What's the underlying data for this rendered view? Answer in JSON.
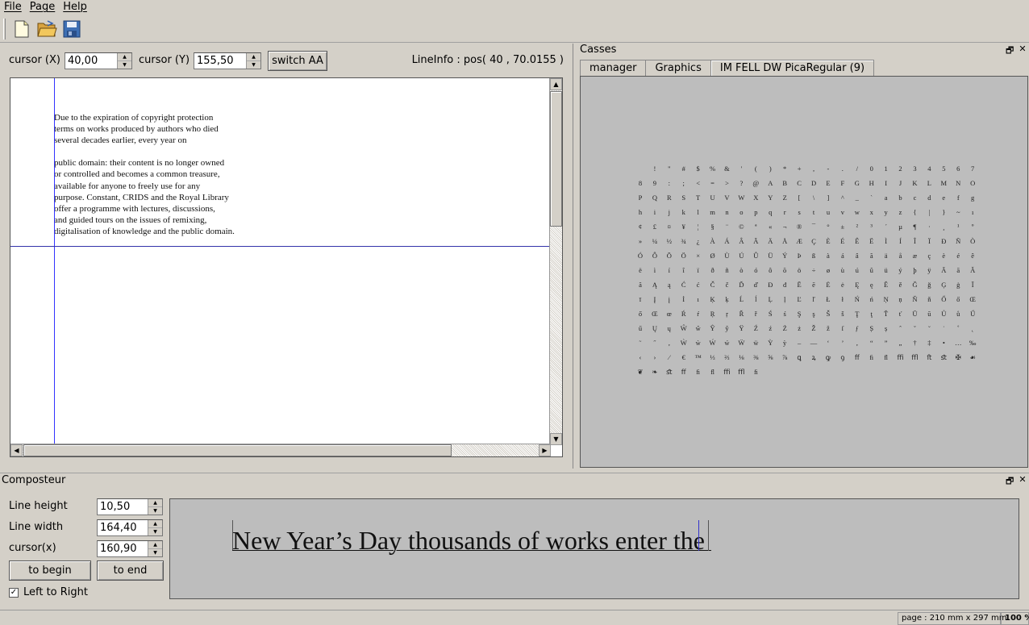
{
  "menu": {
    "file": "File",
    "page": "Page",
    "help": "Help"
  },
  "toolbar": {
    "new": "new-document-icon",
    "open": "open-folder-icon",
    "save": "save-disk-icon"
  },
  "view": {
    "cursor_x_label": "cursor (X)",
    "cursor_x_value": "40,00",
    "cursor_y_label": "cursor (Y)",
    "cursor_y_value": "155,50",
    "switch_aa": "switch AA",
    "lineinfo": "LineInfo : pos( 40 , 70.0155 )"
  },
  "document": {
    "lines": [
      "Due to the expiration of copyright protection",
      "terms on works produced by authors who died",
      "several decades earlier, every year on",
      "",
      "public domain: their content is no longer owned",
      "or controlled and becomes a common treasure,",
      "available for anyone to freely use for any",
      "purpose. Constant, CRIDS and the Royal Library",
      "offer a programme with lectures, discussions,",
      "and guided tours on the issues of remixing,",
      "digitalisation of knowledge and the public domain."
    ]
  },
  "casses": {
    "title": "Casses",
    "tabs": [
      "manager",
      "Graphics",
      "IM FELL DW PicaRegular (9)"
    ],
    "glyph_rows": [
      [
        "",
        "!",
        "\"",
        "#",
        "$",
        "%",
        "&",
        "'",
        "(",
        ")",
        "*",
        "+",
        ",",
        "-",
        ".",
        "/",
        "0",
        "1",
        "2",
        "3",
        "4",
        "5",
        "6",
        "7"
      ],
      [
        "8",
        "9",
        ":",
        ";",
        "<",
        "=",
        ">",
        "?",
        "@",
        "A",
        "B",
        "C",
        "D",
        "E",
        "F",
        "G",
        "H",
        "I",
        "J",
        "K",
        "L",
        "M",
        "N",
        "O"
      ],
      [
        "P",
        "Q",
        "R",
        "S",
        "T",
        "U",
        "V",
        "W",
        "X",
        "Y",
        "Z",
        "[",
        "\\",
        "]",
        "^",
        "_",
        "`",
        "a",
        "b",
        "c",
        "d",
        "e",
        "f",
        "g"
      ],
      [
        "h",
        "i",
        "j",
        "k",
        "l",
        "m",
        "n",
        "o",
        "p",
        "q",
        "r",
        "s",
        "t",
        "u",
        "v",
        "w",
        "x",
        "y",
        "z",
        "{",
        "|",
        "}",
        "~",
        "ı"
      ],
      [
        "¢",
        "£",
        "¤",
        "¥",
        "¦",
        "§",
        "¨",
        "©",
        "ª",
        "«",
        "¬",
        "®",
        "¯",
        "°",
        "±",
        "²",
        "³",
        "´",
        "µ",
        "¶",
        "·",
        "¸",
        "¹",
        "º"
      ],
      [
        "»",
        "¼",
        "½",
        "¾",
        "¿",
        "À",
        "Á",
        "Â",
        "Ã",
        "Ä",
        "Å",
        "Æ",
        "Ç",
        "È",
        "É",
        "Ê",
        "Ë",
        "Ì",
        "Í",
        "Î",
        "Ï",
        "Ð",
        "Ñ",
        "Ò"
      ],
      [
        "Ó",
        "Ô",
        "Õ",
        "Ö",
        "×",
        "Ø",
        "Ù",
        "Ú",
        "Û",
        "Ü",
        "Ý",
        "Þ",
        "ß",
        "à",
        "á",
        "â",
        "ã",
        "ä",
        "å",
        "æ",
        "ç",
        "è",
        "é",
        "ê"
      ],
      [
        "ë",
        "ì",
        "í",
        "î",
        "ï",
        "ð",
        "ñ",
        "ò",
        "ó",
        "ô",
        "õ",
        "ö",
        "÷",
        "ø",
        "ù",
        "ú",
        "û",
        "ü",
        "ý",
        "þ",
        "ÿ",
        "Ā",
        "ā",
        "Ă"
      ],
      [
        "ă",
        "Ą",
        "ą",
        "Ć",
        "ć",
        "Č",
        "č",
        "Ď",
        "ď",
        "Đ",
        "đ",
        "Ē",
        "ē",
        "Ė",
        "ė",
        "Ę",
        "ę",
        "Ě",
        "ě",
        "Ğ",
        "ğ",
        "Ģ",
        "ģ",
        "Ī"
      ],
      [
        "ī",
        "Į",
        "į",
        "İ",
        "ı",
        "Ķ",
        "ķ",
        "Ĺ",
        "ĺ",
        "Ļ",
        "ļ",
        "Ľ",
        "ľ",
        "Ł",
        "ł",
        "Ń",
        "ń",
        "Ņ",
        "ņ",
        "Ň",
        "ň",
        "Ő",
        "ő",
        "Œ"
      ],
      [
        "ő",
        "Œ",
        "œ",
        "Ŕ",
        "ŕ",
        "Ŗ",
        "ŗ",
        "Ř",
        "ř",
        "Ś",
        "ś",
        "Ş",
        "ş",
        "Š",
        "š",
        "Ţ",
        "ţ",
        "Ť",
        "ť",
        "Ū",
        "ū",
        "Ů",
        "ů",
        "Ű"
      ],
      [
        "ű",
        "Ų",
        "ų",
        "Ŵ",
        "ŵ",
        "Ŷ",
        "ŷ",
        "Ÿ",
        "Ź",
        "ź",
        "Ż",
        "ż",
        "Ž",
        "ž",
        "ſ",
        "ƒ",
        "Ș",
        "ș",
        "ˆ",
        "ˇ",
        "˘",
        "˙",
        "˚",
        "˛"
      ],
      [
        "˜",
        "˝",
        "‚",
        "Ẁ",
        "ẁ",
        "Ẃ",
        "ẃ",
        "Ẅ",
        "ẅ",
        "Ỳ",
        "ỳ",
        "–",
        "—",
        "‘",
        "’",
        "‚",
        "“",
        "”",
        "„",
        "†",
        "‡",
        "•",
        "…",
        "‰"
      ],
      [
        "‹",
        "›",
        "⁄",
        "€",
        "™",
        "⅓",
        "⅔",
        "⅛",
        "⅜",
        "⅝",
        "⅞",
        "ꝗ",
        "ꝝ",
        "ꝙ",
        "ꝯ",
        "ﬀ",
        "ﬁ",
        "ﬂ",
        "ﬃ",
        "ﬄ",
        "ﬅ",
        "ﬆ",
        "✠",
        "☙"
      ],
      [
        "❦",
        "❧",
        "ﬆ",
        "ﬀ",
        "ﬁ",
        "ﬂ",
        "ﬃ",
        "ﬄ",
        "ﬁ",
        "",
        "",
        "",
        "",
        "",
        "",
        "",
        "",
        "",
        "",
        "",
        "",
        "",
        "",
        ""
      ]
    ]
  },
  "composteur": {
    "title": "Composteur",
    "line_height_label": "Line height",
    "line_height_value": "10,50",
    "line_width_label": "Line width",
    "line_width_value": "164,40",
    "cursor_x_label": "cursor(x)",
    "cursor_x_value": "160,90",
    "to_begin": "to begin",
    "to_end": "to end",
    "ltr_label": "Left to Right",
    "ltr_checked": true,
    "text": "New Year’s Day thousands of works enter the "
  },
  "status": {
    "page": "page : 210 mm x 297 mm",
    "zoom": "100 %"
  }
}
